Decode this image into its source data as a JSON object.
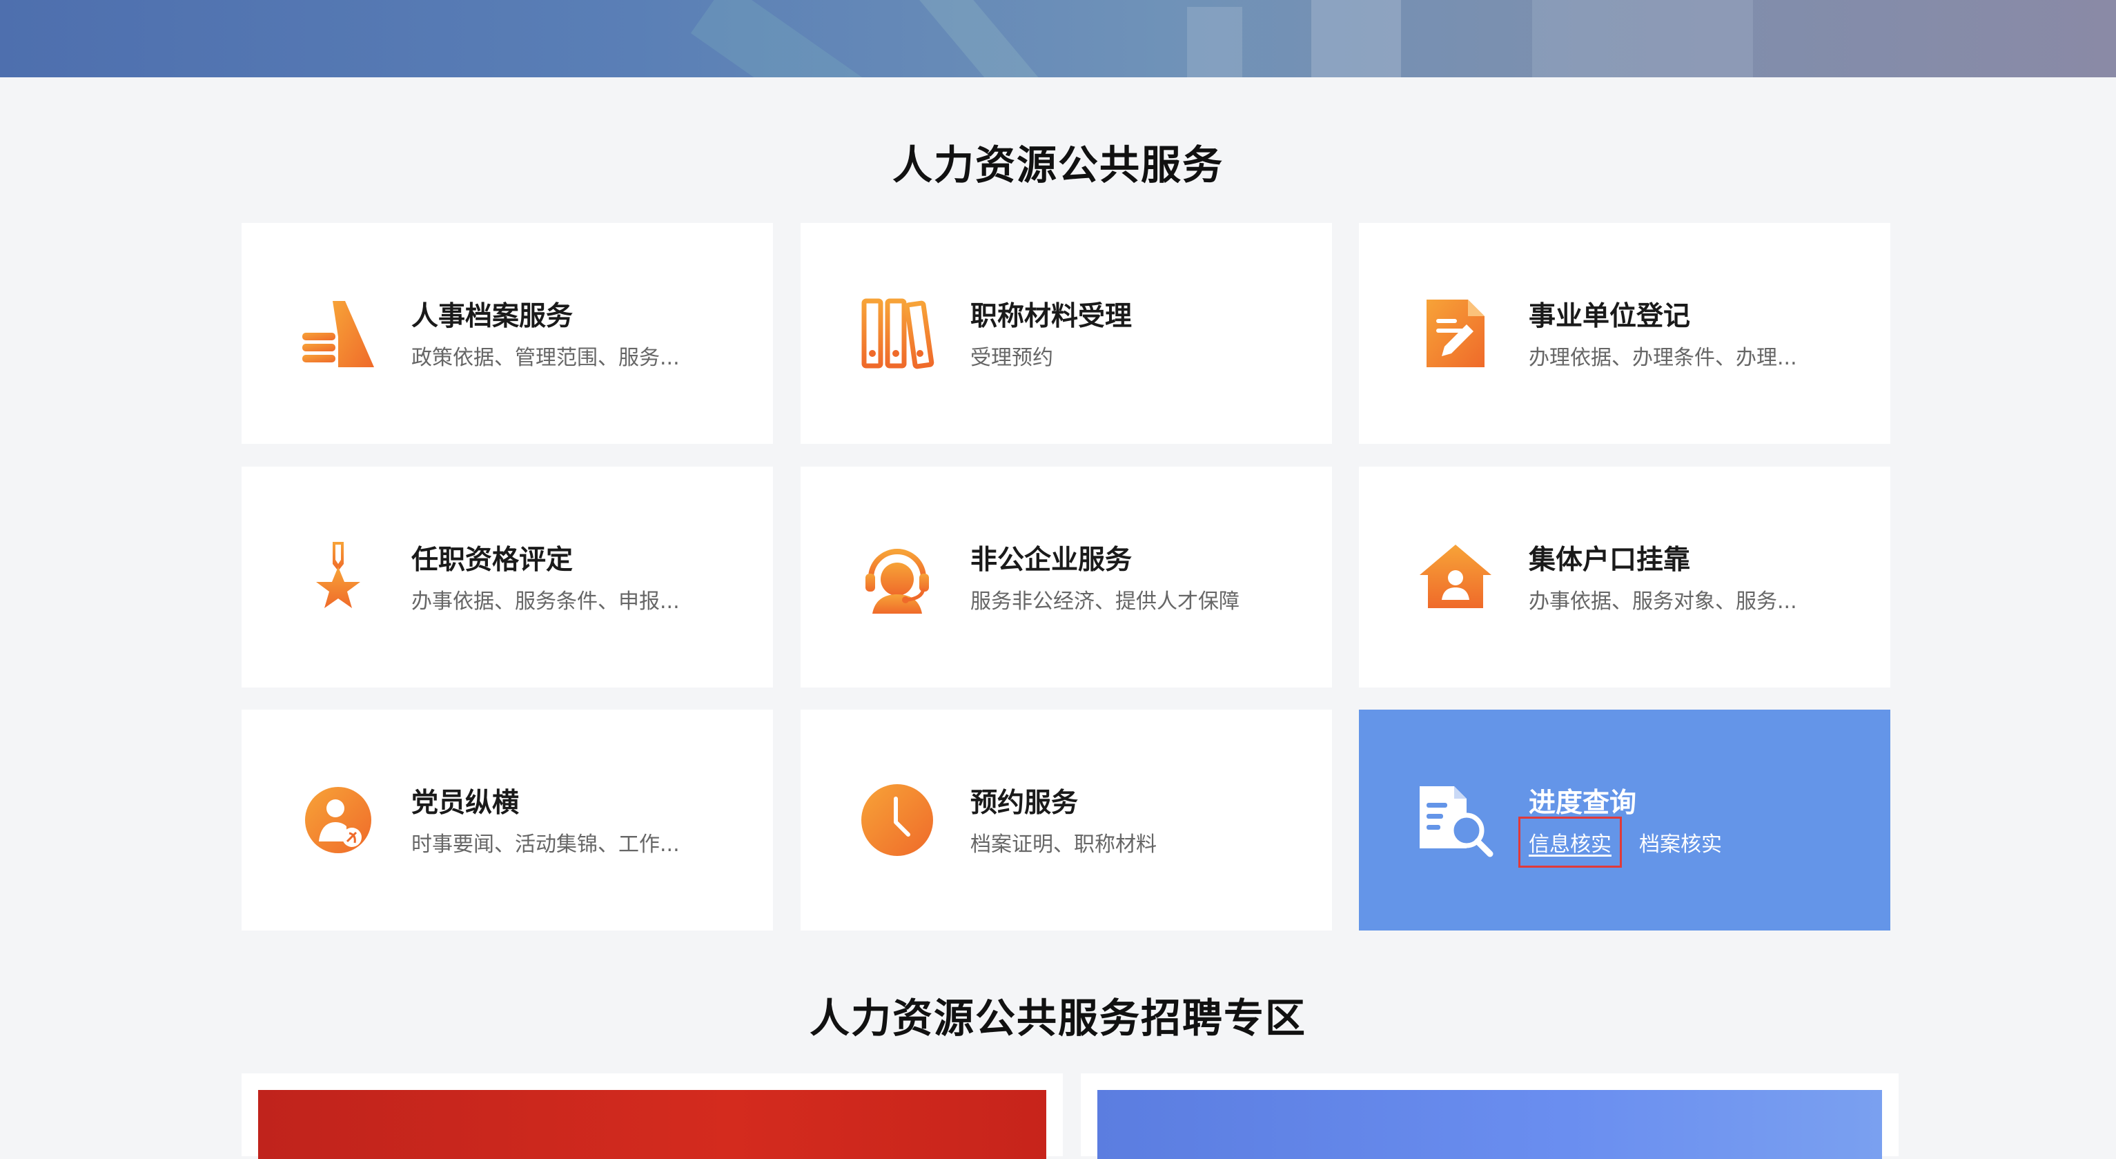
{
  "sections": {
    "services_title": "人力资源公共服务",
    "recruit_title": "人力资源公共服务招聘专区"
  },
  "cards": [
    {
      "title": "人事档案服务",
      "desc": "政策依据、管理范围、服务...",
      "icon": "thumbs-up-icon"
    },
    {
      "title": "职称材料受理",
      "desc": "受理预约",
      "icon": "binders-icon"
    },
    {
      "title": "事业单位登记",
      "desc": "办理依据、办理条件、办理...",
      "icon": "document-edit-icon"
    },
    {
      "title": "任职资格评定",
      "desc": "办事依据、服务条件、申报...",
      "icon": "medal-star-icon"
    },
    {
      "title": "非公企业服务",
      "desc": "服务非公经济、提供人才保障",
      "icon": "headset-support-icon"
    },
    {
      "title": "集体户口挂靠",
      "desc": "办事依据、服务对象、服务...",
      "icon": "house-person-icon"
    },
    {
      "title": "党员纵横",
      "desc": "时事要闻、活动集锦、工作...",
      "icon": "party-member-icon"
    },
    {
      "title": "预约服务",
      "desc": "档案证明、职称材料",
      "icon": "clock-icon"
    }
  ],
  "progress_card": {
    "title": "进度查询",
    "links": [
      "信息核实",
      "档案核实"
    ],
    "selected_link": "信息核实",
    "icon": "document-search-icon"
  },
  "colors": {
    "accent_orange": "#f08a2e",
    "active_card_blue": "#6495e8",
    "selection_box": "#e03a3a"
  }
}
